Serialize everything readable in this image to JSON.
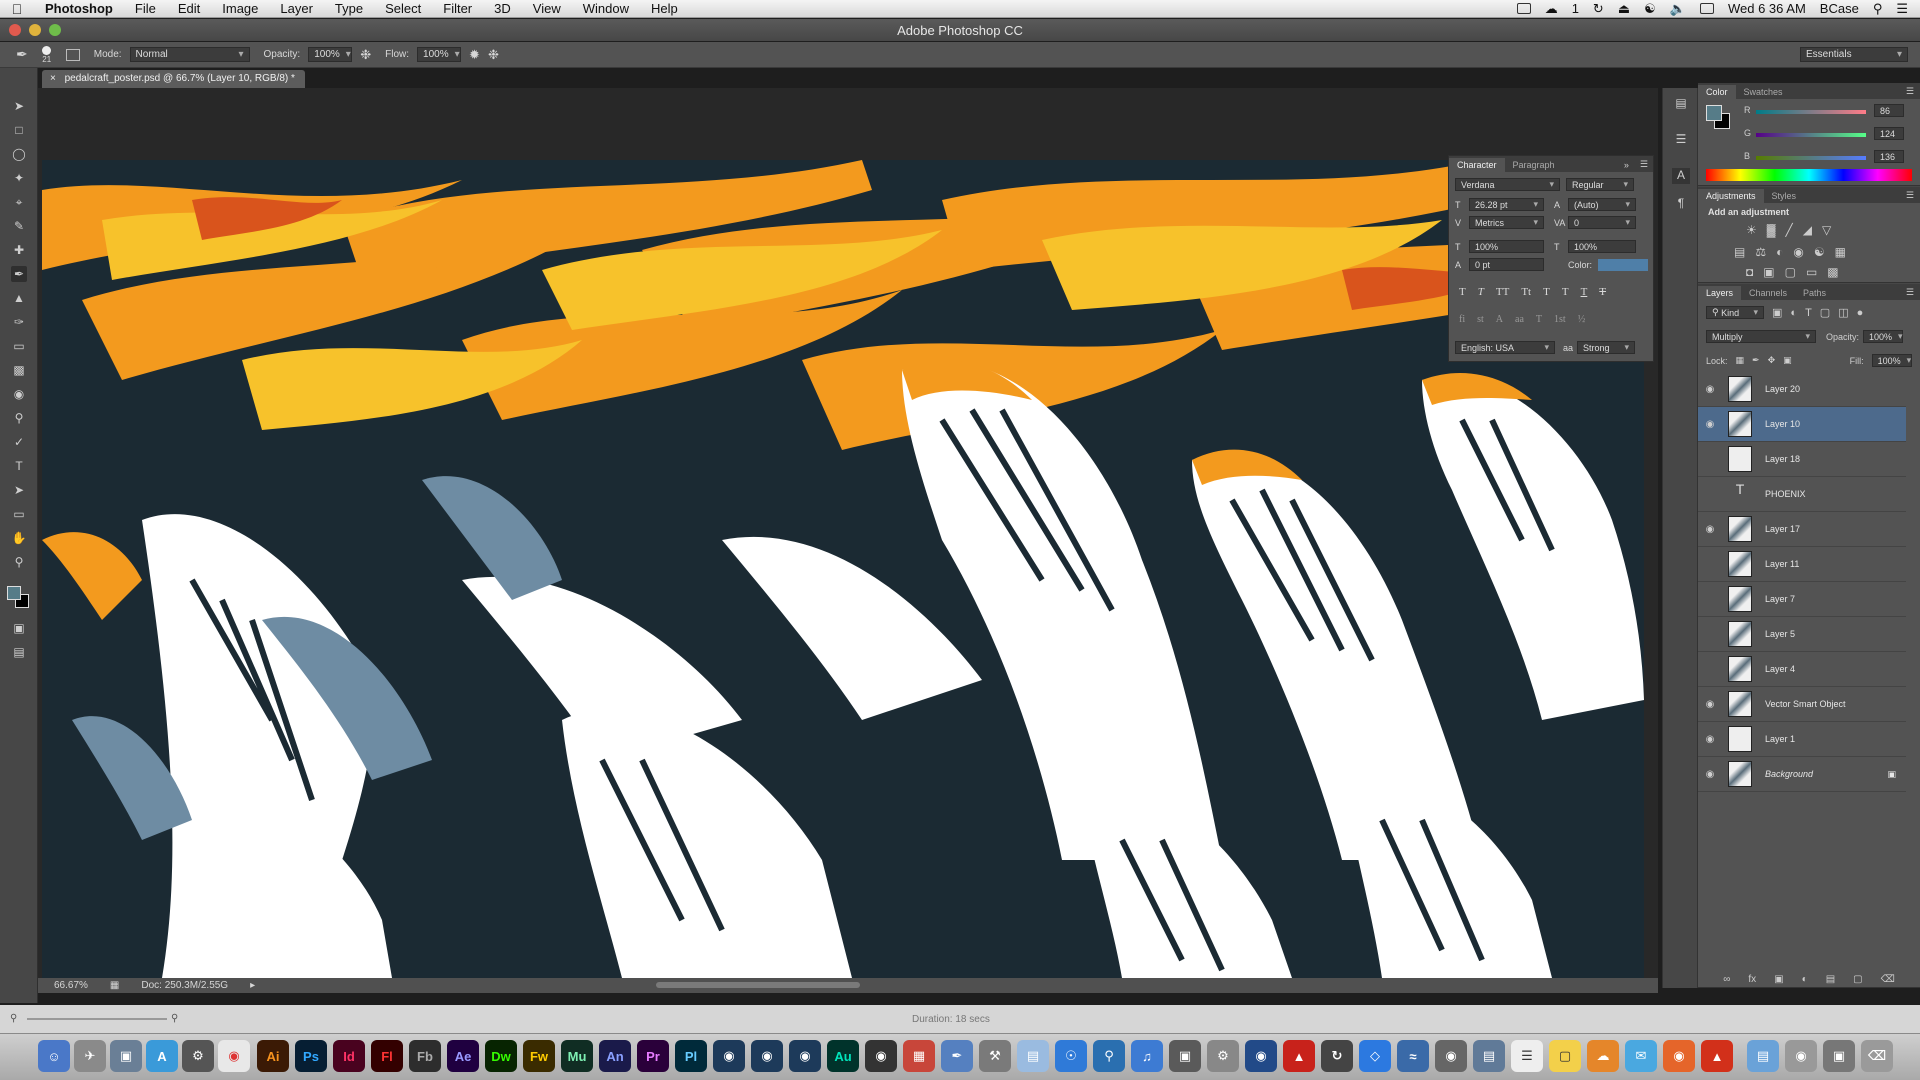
{
  "menubar": {
    "app": "Photoshop",
    "menus": [
      "File",
      "Edit",
      "Image",
      "Layer",
      "Type",
      "Select",
      "Filter",
      "3D",
      "View",
      "Window",
      "Help"
    ],
    "status": "Wed 6 36 AM",
    "user": "BCase",
    "wifi_count": "1"
  },
  "window": {
    "title": "Adobe Photoshop CC",
    "document_tab": "pedalcraft_poster.psd @ 66.7% (Layer 10, RGB/8) *"
  },
  "options": {
    "brush_size": "21",
    "mode_label": "Mode:",
    "mode_value": "Normal",
    "opacity_label": "Opacity:",
    "opacity_value": "100%",
    "flow_label": "Flow:",
    "flow_value": "100%",
    "workspace": "Essentials"
  },
  "status": {
    "zoom": "66.67%",
    "doc": "Doc: 250.3M/2.55G"
  },
  "timeline": {
    "duration": "Duration: 18 secs"
  },
  "character": {
    "tabs": [
      "Character",
      "Paragraph"
    ],
    "font_family": "Verdana",
    "font_style": "Regular",
    "font_size": "26.28 pt",
    "leading": "(Auto)",
    "kerning": "Metrics",
    "tracking": "0",
    "vscale": "100%",
    "hscale": "100%",
    "baseline": "0 pt",
    "color_label": "Color:",
    "color_value": "#4f7fa8",
    "type_buttons": [
      "T",
      "T",
      "TT",
      "Tt",
      "T",
      "T",
      "T",
      "T"
    ],
    "ot_buttons": [
      "fi",
      "st",
      "A",
      "aa",
      "T",
      "1st",
      "½"
    ],
    "language": "English: USA",
    "aa_label": "aa",
    "antialias": "Strong"
  },
  "color_panel": {
    "tabs": [
      "Color",
      "Swatches"
    ],
    "r_label": "R",
    "g_label": "G",
    "b_label": "B",
    "r": "86",
    "g": "124",
    "b": "136",
    "fg": "#567c88",
    "bg": "#000000"
  },
  "adjustments": {
    "tabs": [
      "Adjustments",
      "Styles"
    ],
    "heading": "Add an adjustment"
  },
  "layers": {
    "tabs": [
      "Layers",
      "Channels",
      "Paths"
    ],
    "kind": "Kind",
    "blend_mode": "Multiply",
    "opacity_label": "Opacity:",
    "opacity": "100%",
    "lock_label": "Lock:",
    "fill_label": "Fill:",
    "fill": "100%",
    "items": [
      {
        "name": "Layer 20",
        "visible": true,
        "selected": false,
        "kind": "art"
      },
      {
        "name": "Layer 10",
        "visible": true,
        "selected": true,
        "kind": "art"
      },
      {
        "name": "Layer 18",
        "visible": false,
        "selected": false,
        "kind": "plain"
      },
      {
        "name": "PHOENIX",
        "visible": false,
        "selected": false,
        "kind": "text"
      },
      {
        "name": "Layer 17",
        "visible": true,
        "selected": false,
        "kind": "art"
      },
      {
        "name": "Layer 11",
        "visible": false,
        "selected": false,
        "kind": "art"
      },
      {
        "name": "Layer 7",
        "visible": false,
        "selected": false,
        "kind": "art"
      },
      {
        "name": "Layer 5",
        "visible": false,
        "selected": false,
        "kind": "art"
      },
      {
        "name": "Layer 4",
        "visible": false,
        "selected": false,
        "kind": "art"
      },
      {
        "name": "Vector Smart Object",
        "visible": true,
        "selected": false,
        "kind": "art"
      },
      {
        "name": "Layer 1",
        "visible": true,
        "selected": false,
        "kind": "plain"
      },
      {
        "name": "Background",
        "visible": true,
        "selected": false,
        "kind": "art"
      }
    ]
  },
  "dock": {
    "apps": [
      "Ai",
      "Ps",
      "Id",
      "Fl",
      "Fb",
      "Ae",
      "Dw",
      "Fw",
      "Mu",
      "An",
      "Pr",
      "Pl",
      "Au"
    ]
  },
  "colors": {
    "selected_layer": "#4d6a8c",
    "art_dark": "#1b2a33",
    "art_orange": "#f39a1e",
    "art_yellow": "#f7c22b",
    "art_blue": "#6e8ca3"
  }
}
